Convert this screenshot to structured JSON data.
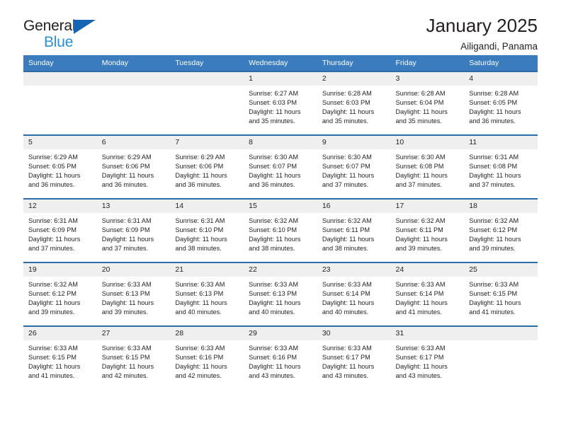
{
  "brand": {
    "name_part1": "General",
    "name_part2": "Blue",
    "accent_color": "#2a8fd4",
    "triangle_color": "#1565b5"
  },
  "header": {
    "title": "January 2025",
    "location": "Ailigandi, Panama"
  },
  "theme": {
    "header_bar_color": "#3a7cbe",
    "row_border_color": "#2c6da8",
    "daynum_bg": "#efefef",
    "text_color": "#231f20"
  },
  "weekday_headers": [
    "Sunday",
    "Monday",
    "Tuesday",
    "Wednesday",
    "Thursday",
    "Friday",
    "Saturday"
  ],
  "weeks": [
    [
      {
        "day": "",
        "empty": true,
        "sunrise": "",
        "sunset": "",
        "daylight_line1": "",
        "daylight_line2": ""
      },
      {
        "day": "",
        "empty": true,
        "sunrise": "",
        "sunset": "",
        "daylight_line1": "",
        "daylight_line2": ""
      },
      {
        "day": "",
        "empty": true,
        "sunrise": "",
        "sunset": "",
        "daylight_line1": "",
        "daylight_line2": ""
      },
      {
        "day": "1",
        "empty": false,
        "sunrise": "Sunrise: 6:27 AM",
        "sunset": "Sunset: 6:03 PM",
        "daylight_line1": "Daylight: 11 hours",
        "daylight_line2": "and 35 minutes."
      },
      {
        "day": "2",
        "empty": false,
        "sunrise": "Sunrise: 6:28 AM",
        "sunset": "Sunset: 6:03 PM",
        "daylight_line1": "Daylight: 11 hours",
        "daylight_line2": "and 35 minutes."
      },
      {
        "day": "3",
        "empty": false,
        "sunrise": "Sunrise: 6:28 AM",
        "sunset": "Sunset: 6:04 PM",
        "daylight_line1": "Daylight: 11 hours",
        "daylight_line2": "and 35 minutes."
      },
      {
        "day": "4",
        "empty": false,
        "sunrise": "Sunrise: 6:28 AM",
        "sunset": "Sunset: 6:05 PM",
        "daylight_line1": "Daylight: 11 hours",
        "daylight_line2": "and 36 minutes."
      }
    ],
    [
      {
        "day": "5",
        "empty": false,
        "sunrise": "Sunrise: 6:29 AM",
        "sunset": "Sunset: 6:05 PM",
        "daylight_line1": "Daylight: 11 hours",
        "daylight_line2": "and 36 minutes."
      },
      {
        "day": "6",
        "empty": false,
        "sunrise": "Sunrise: 6:29 AM",
        "sunset": "Sunset: 6:06 PM",
        "daylight_line1": "Daylight: 11 hours",
        "daylight_line2": "and 36 minutes."
      },
      {
        "day": "7",
        "empty": false,
        "sunrise": "Sunrise: 6:29 AM",
        "sunset": "Sunset: 6:06 PM",
        "daylight_line1": "Daylight: 11 hours",
        "daylight_line2": "and 36 minutes."
      },
      {
        "day": "8",
        "empty": false,
        "sunrise": "Sunrise: 6:30 AM",
        "sunset": "Sunset: 6:07 PM",
        "daylight_line1": "Daylight: 11 hours",
        "daylight_line2": "and 36 minutes."
      },
      {
        "day": "9",
        "empty": false,
        "sunrise": "Sunrise: 6:30 AM",
        "sunset": "Sunset: 6:07 PM",
        "daylight_line1": "Daylight: 11 hours",
        "daylight_line2": "and 37 minutes."
      },
      {
        "day": "10",
        "empty": false,
        "sunrise": "Sunrise: 6:30 AM",
        "sunset": "Sunset: 6:08 PM",
        "daylight_line1": "Daylight: 11 hours",
        "daylight_line2": "and 37 minutes."
      },
      {
        "day": "11",
        "empty": false,
        "sunrise": "Sunrise: 6:31 AM",
        "sunset": "Sunset: 6:08 PM",
        "daylight_line1": "Daylight: 11 hours",
        "daylight_line2": "and 37 minutes."
      }
    ],
    [
      {
        "day": "12",
        "empty": false,
        "sunrise": "Sunrise: 6:31 AM",
        "sunset": "Sunset: 6:09 PM",
        "daylight_line1": "Daylight: 11 hours",
        "daylight_line2": "and 37 minutes."
      },
      {
        "day": "13",
        "empty": false,
        "sunrise": "Sunrise: 6:31 AM",
        "sunset": "Sunset: 6:09 PM",
        "daylight_line1": "Daylight: 11 hours",
        "daylight_line2": "and 37 minutes."
      },
      {
        "day": "14",
        "empty": false,
        "sunrise": "Sunrise: 6:31 AM",
        "sunset": "Sunset: 6:10 PM",
        "daylight_line1": "Daylight: 11 hours",
        "daylight_line2": "and 38 minutes."
      },
      {
        "day": "15",
        "empty": false,
        "sunrise": "Sunrise: 6:32 AM",
        "sunset": "Sunset: 6:10 PM",
        "daylight_line1": "Daylight: 11 hours",
        "daylight_line2": "and 38 minutes."
      },
      {
        "day": "16",
        "empty": false,
        "sunrise": "Sunrise: 6:32 AM",
        "sunset": "Sunset: 6:11 PM",
        "daylight_line1": "Daylight: 11 hours",
        "daylight_line2": "and 38 minutes."
      },
      {
        "day": "17",
        "empty": false,
        "sunrise": "Sunrise: 6:32 AM",
        "sunset": "Sunset: 6:11 PM",
        "daylight_line1": "Daylight: 11 hours",
        "daylight_line2": "and 39 minutes."
      },
      {
        "day": "18",
        "empty": false,
        "sunrise": "Sunrise: 6:32 AM",
        "sunset": "Sunset: 6:12 PM",
        "daylight_line1": "Daylight: 11 hours",
        "daylight_line2": "and 39 minutes."
      }
    ],
    [
      {
        "day": "19",
        "empty": false,
        "sunrise": "Sunrise: 6:32 AM",
        "sunset": "Sunset: 6:12 PM",
        "daylight_line1": "Daylight: 11 hours",
        "daylight_line2": "and 39 minutes."
      },
      {
        "day": "20",
        "empty": false,
        "sunrise": "Sunrise: 6:33 AM",
        "sunset": "Sunset: 6:13 PM",
        "daylight_line1": "Daylight: 11 hours",
        "daylight_line2": "and 39 minutes."
      },
      {
        "day": "21",
        "empty": false,
        "sunrise": "Sunrise: 6:33 AM",
        "sunset": "Sunset: 6:13 PM",
        "daylight_line1": "Daylight: 11 hours",
        "daylight_line2": "and 40 minutes."
      },
      {
        "day": "22",
        "empty": false,
        "sunrise": "Sunrise: 6:33 AM",
        "sunset": "Sunset: 6:13 PM",
        "daylight_line1": "Daylight: 11 hours",
        "daylight_line2": "and 40 minutes."
      },
      {
        "day": "23",
        "empty": false,
        "sunrise": "Sunrise: 6:33 AM",
        "sunset": "Sunset: 6:14 PM",
        "daylight_line1": "Daylight: 11 hours",
        "daylight_line2": "and 40 minutes."
      },
      {
        "day": "24",
        "empty": false,
        "sunrise": "Sunrise: 6:33 AM",
        "sunset": "Sunset: 6:14 PM",
        "daylight_line1": "Daylight: 11 hours",
        "daylight_line2": "and 41 minutes."
      },
      {
        "day": "25",
        "empty": false,
        "sunrise": "Sunrise: 6:33 AM",
        "sunset": "Sunset: 6:15 PM",
        "daylight_line1": "Daylight: 11 hours",
        "daylight_line2": "and 41 minutes."
      }
    ],
    [
      {
        "day": "26",
        "empty": false,
        "sunrise": "Sunrise: 6:33 AM",
        "sunset": "Sunset: 6:15 PM",
        "daylight_line1": "Daylight: 11 hours",
        "daylight_line2": "and 41 minutes."
      },
      {
        "day": "27",
        "empty": false,
        "sunrise": "Sunrise: 6:33 AM",
        "sunset": "Sunset: 6:15 PM",
        "daylight_line1": "Daylight: 11 hours",
        "daylight_line2": "and 42 minutes."
      },
      {
        "day": "28",
        "empty": false,
        "sunrise": "Sunrise: 6:33 AM",
        "sunset": "Sunset: 6:16 PM",
        "daylight_line1": "Daylight: 11 hours",
        "daylight_line2": "and 42 minutes."
      },
      {
        "day": "29",
        "empty": false,
        "sunrise": "Sunrise: 6:33 AM",
        "sunset": "Sunset: 6:16 PM",
        "daylight_line1": "Daylight: 11 hours",
        "daylight_line2": "and 43 minutes."
      },
      {
        "day": "30",
        "empty": false,
        "sunrise": "Sunrise: 6:33 AM",
        "sunset": "Sunset: 6:17 PM",
        "daylight_line1": "Daylight: 11 hours",
        "daylight_line2": "and 43 minutes."
      },
      {
        "day": "31",
        "empty": false,
        "sunrise": "Sunrise: 6:33 AM",
        "sunset": "Sunset: 6:17 PM",
        "daylight_line1": "Daylight: 11 hours",
        "daylight_line2": "and 43 minutes."
      },
      {
        "day": "",
        "empty": true,
        "sunrise": "",
        "sunset": "",
        "daylight_line1": "",
        "daylight_line2": ""
      }
    ]
  ]
}
